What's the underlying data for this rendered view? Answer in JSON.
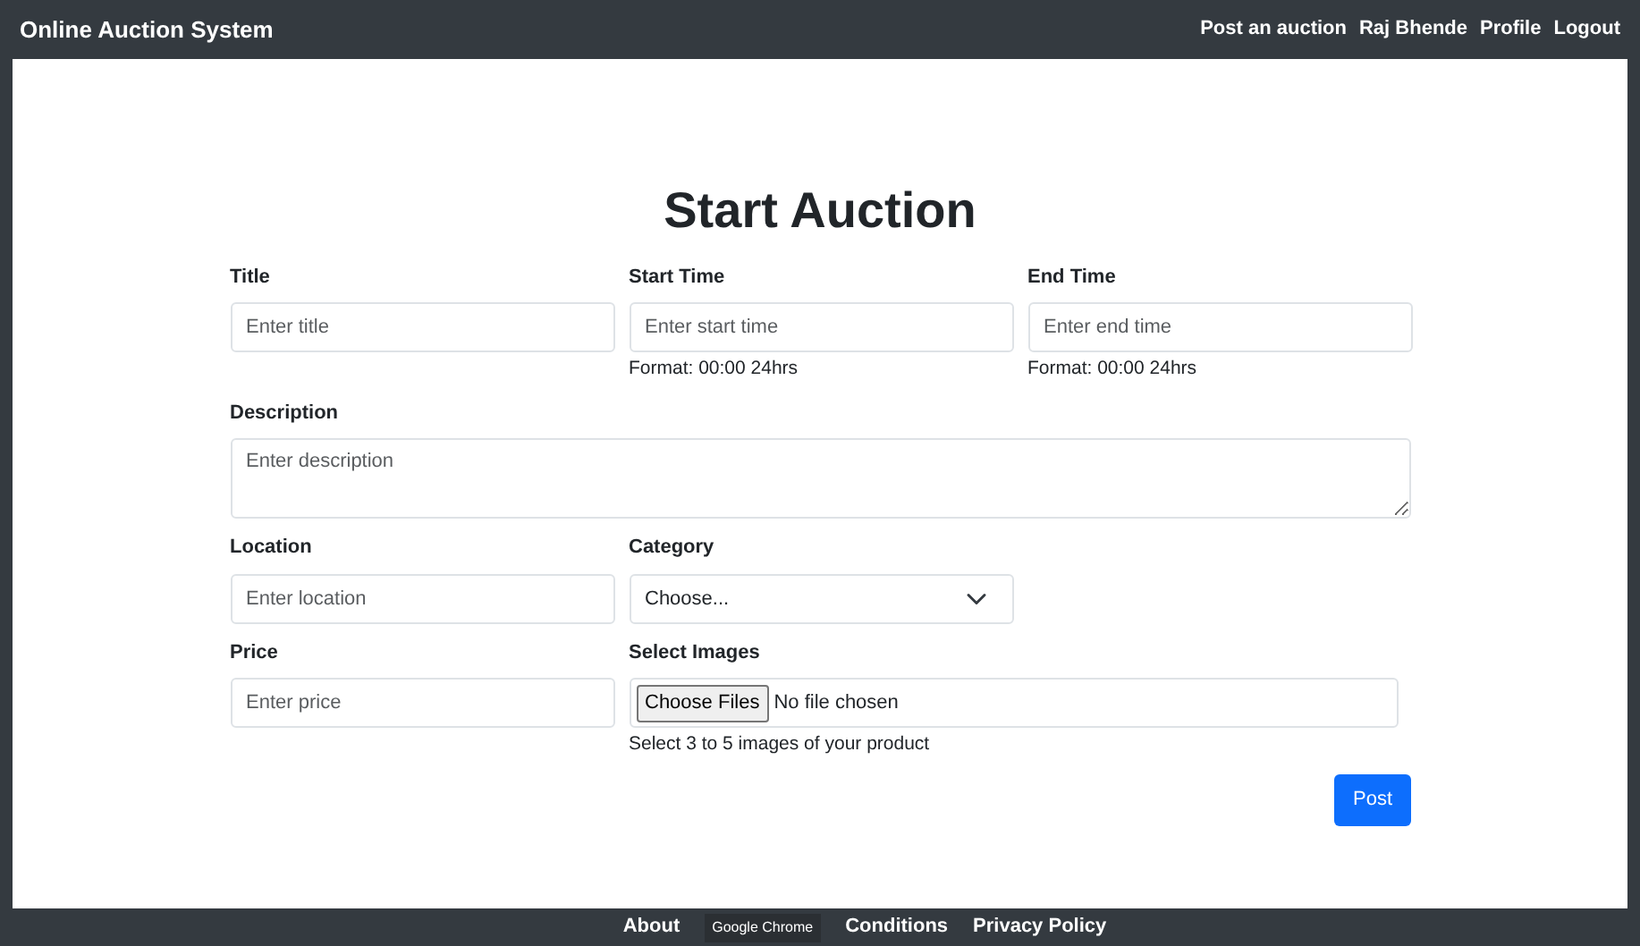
{
  "navbar": {
    "brand": "Online Auction System",
    "links": [
      "Post an auction",
      "Raj Bhende",
      "Profile",
      "Logout"
    ]
  },
  "heading": "Start Auction",
  "fields": [
    {
      "kind": "text",
      "label": "Title",
      "placeholder": "Enter title"
    },
    {
      "kind": "text",
      "label": "Start Time",
      "placeholder": "Enter start time",
      "help": "Format: 00:00 24hrs"
    },
    {
      "kind": "text",
      "label": "End Time",
      "placeholder": "Enter end time",
      "help": "Format: 00:00 24hrs"
    },
    {
      "kind": "textarea",
      "label": "Description",
      "placeholder": "Enter description"
    },
    {
      "kind": "text",
      "label": "Location",
      "placeholder": "Enter location"
    },
    {
      "kind": "select",
      "label": "Category",
      "value": "Choose..."
    },
    {
      "kind": "text",
      "label": "Price",
      "placeholder": "Enter price"
    },
    {
      "kind": "file",
      "label": "Select Images",
      "button": "Choose Files",
      "status": "No file chosen",
      "help": "Select 3 to 5 images of your product"
    }
  ],
  "submit": "Post",
  "footer": {
    "links": [
      "About",
      "Conditions",
      "Privacy Policy"
    ],
    "tooltip": "Google Chrome"
  }
}
